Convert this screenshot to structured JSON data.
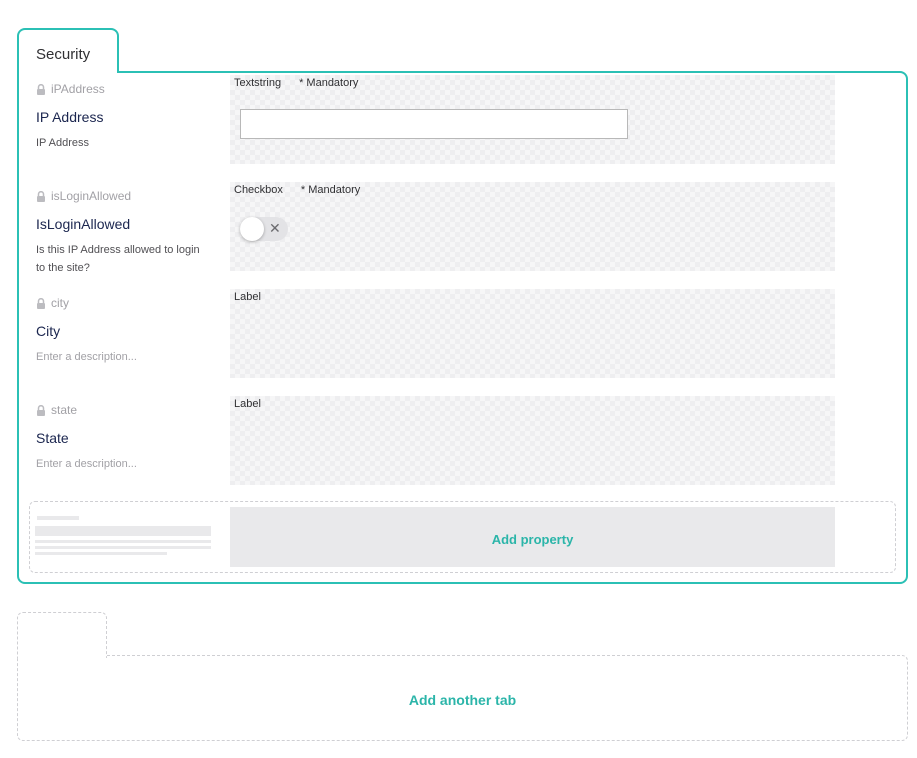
{
  "tab": {
    "label": "Security"
  },
  "properties": [
    {
      "alias": "iPAddress",
      "name": "IP Address",
      "description": "IP Address",
      "editor": "Textstring",
      "mandatory": "* Mandatory",
      "preview": "textbox"
    },
    {
      "alias": "isLoginAllowed",
      "name": "IsLoginAllowed",
      "description": "Is this IP Address allowed to login to the site?",
      "editor": "Checkbox",
      "mandatory": "* Mandatory",
      "preview": "toggle",
      "toggle_symbol": "✕"
    },
    {
      "alias": "city",
      "name": "City",
      "description": "Enter a description...",
      "editor": "Label",
      "preview": "none"
    },
    {
      "alias": "state",
      "name": "State",
      "description": "Enter a description...",
      "editor": "Label",
      "preview": "none"
    }
  ],
  "add_property_label": "Add property",
  "add_tab_label": "Add another tab",
  "icons": {
    "lock": "lock-icon",
    "settings": "gear-icon",
    "delete": "trash-icon"
  },
  "colors": {
    "accent": "#2bc0b5",
    "accent_text": "#2bb5a9",
    "muted": "#a2a1a6",
    "text": "#1b264f"
  }
}
